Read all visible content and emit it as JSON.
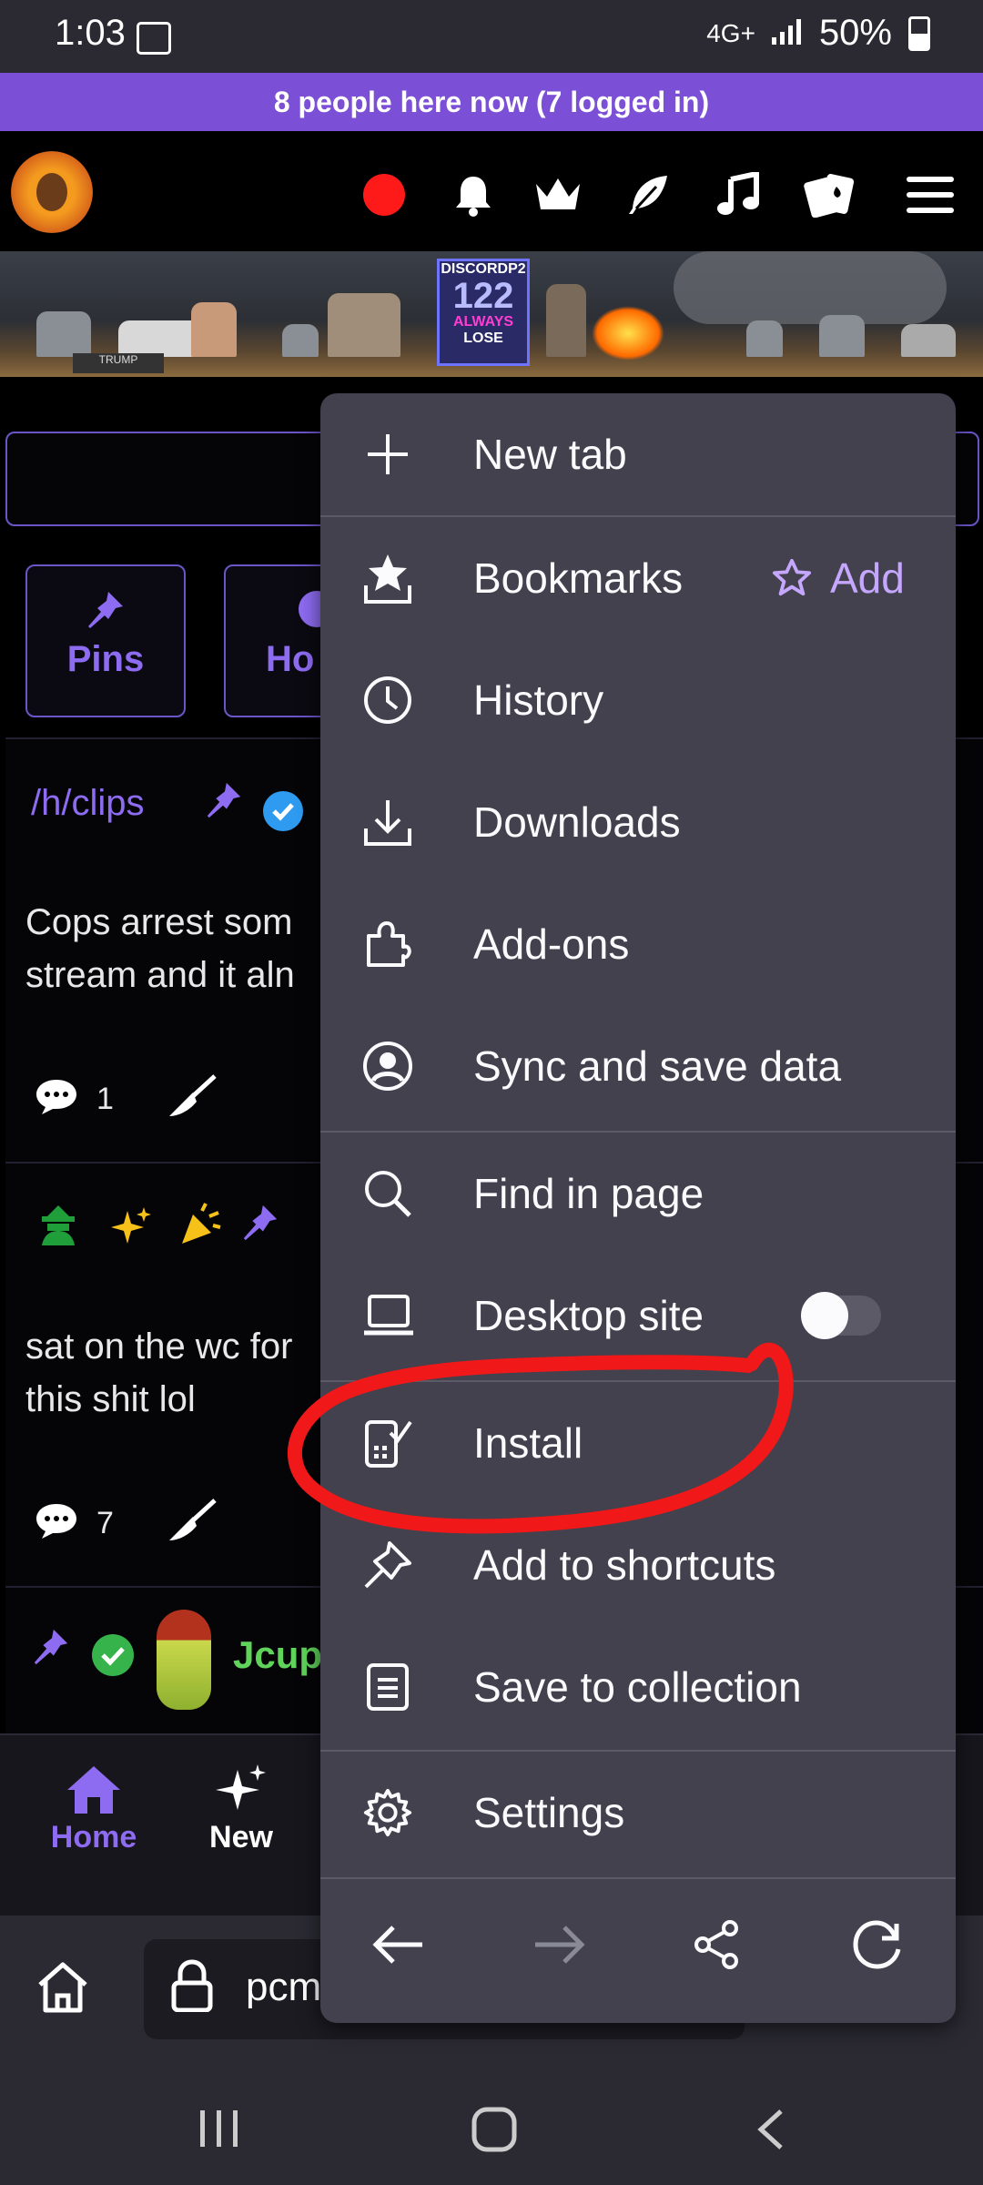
{
  "status_bar": {
    "time": "1:03",
    "network": "4G+",
    "battery": "50%"
  },
  "presence_banner": "8 people here now (7 logged in)",
  "header_icons": [
    "record-dot-icon",
    "bell-icon",
    "crown-icon",
    "feather-icon",
    "music-note-icon",
    "cards-icon",
    "hamburger-menu-icon"
  ],
  "banner_text": {
    "line1": "DISCORDP2",
    "line2": "122",
    "line3": "ALWAYS",
    "line4": "LOSE",
    "sign": "TRUMP"
  },
  "tiles": [
    {
      "label": "Pins"
    },
    {
      "label": "Ho"
    }
  ],
  "posts": [
    {
      "sub": "/h/clips",
      "text_line1": "Cops arrest som",
      "text_line2": "stream and it aln",
      "comments": "1"
    },
    {
      "text_line1": "sat on the wc for",
      "text_line2": "this shit lol",
      "comments": "7"
    },
    {
      "user": "Jcup"
    }
  ],
  "bottom_nav": {
    "home": "Home",
    "new": "New"
  },
  "url_bar": {
    "text": "pcm"
  },
  "menu": {
    "new_tab": "New tab",
    "bookmarks": "Bookmarks",
    "add": "Add",
    "history": "History",
    "downloads": "Downloads",
    "addons": "Add-ons",
    "sync": "Sync and save data",
    "find": "Find in page",
    "desktop": "Desktop site",
    "desktop_enabled": false,
    "install": "Install",
    "shortcuts": "Add to shortcuts",
    "collection": "Save to collection",
    "settings": "Settings"
  },
  "colors": {
    "accent": "#7b4fd6",
    "menu_bg": "#42414d",
    "annotation": "#ff1f1f",
    "bookmark_add": "#c6a7ff"
  }
}
